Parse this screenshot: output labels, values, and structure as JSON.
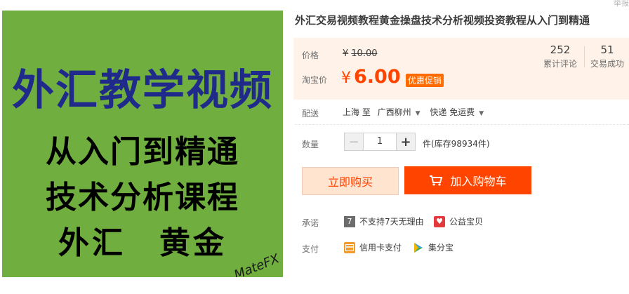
{
  "product_image": {
    "line1": "外汇教学视频",
    "line2": "从入门到精通",
    "line3": "技术分析课程",
    "line4": "外汇　黄金",
    "watermark": "MateFX"
  },
  "corner_text": "举报",
  "title": "外汇交易视频教程黄金操盘技术分析视频投资教程从入门到精通",
  "price": {
    "label": "价格",
    "original_currency": "¥",
    "original_value": "10.00",
    "promo_label": "淘宝价",
    "promo_currency": "¥",
    "promo_value": "6.00",
    "promo_badge": "优惠促销"
  },
  "stats": {
    "reviews_count": "252",
    "reviews_label": "累计评论",
    "deals_count": "51",
    "deals_label": "交易成功"
  },
  "shipping": {
    "label": "配送",
    "from": "上海 至",
    "to": "广西柳州",
    "method": "快递 免运费"
  },
  "quantity": {
    "label": "数量",
    "minus": "−",
    "value": "1",
    "plus": "+",
    "stock_text": "件(库存98934件)"
  },
  "actions": {
    "buy_now": "立即购买",
    "add_to_cart": "加入购物车"
  },
  "promise": {
    "label": "承诺",
    "item1": "不支持7天无理由",
    "item1_icon_text": "7",
    "item2": "公益宝贝"
  },
  "payment": {
    "label": "支付",
    "item1": "信用卡支付",
    "item2": "集分宝"
  },
  "colors": {
    "accent": "#ff4400",
    "image_bg": "#6fae3f"
  }
}
